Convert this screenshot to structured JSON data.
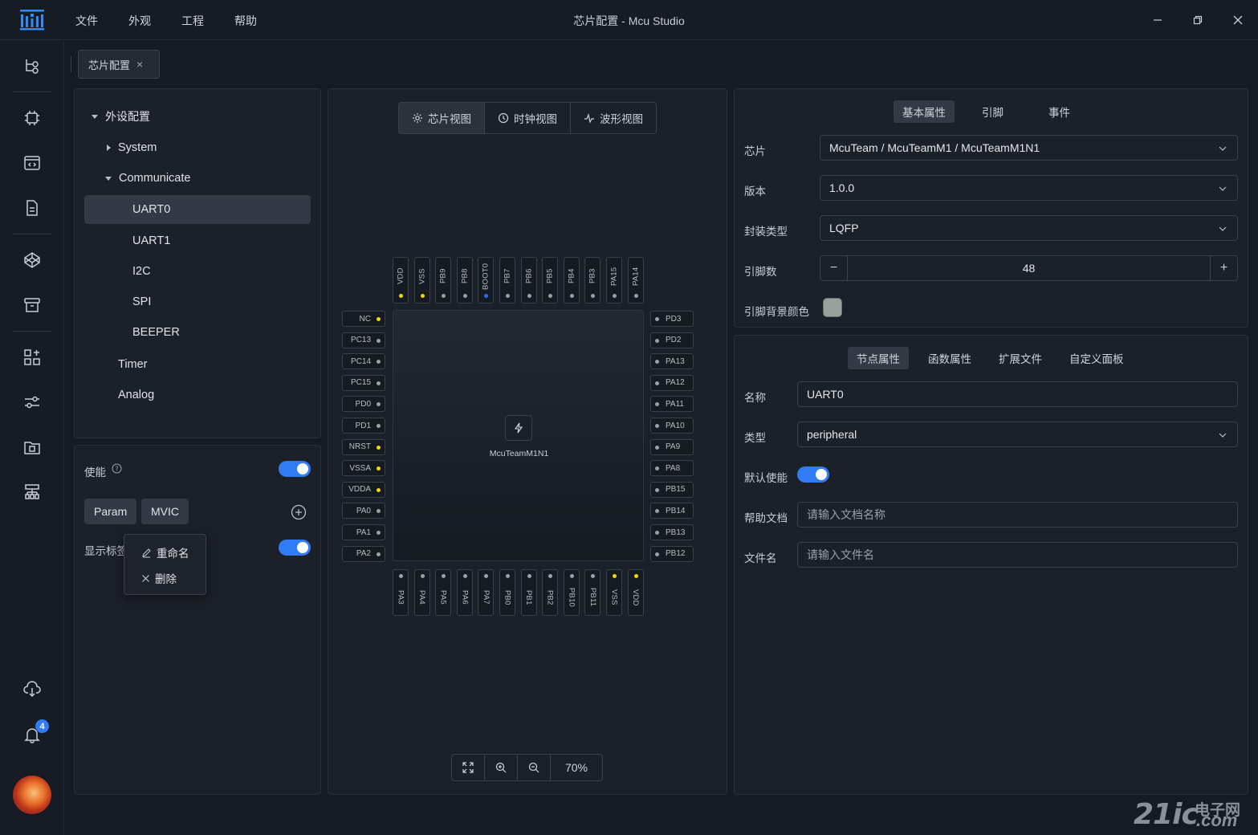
{
  "app": {
    "title": "芯片配置 - Mcu Studio",
    "menu": [
      "文件",
      "外观",
      "工程",
      "帮助"
    ]
  },
  "rail": {
    "icons": [
      "flow-icon",
      "chip-icon",
      "code-window-icon",
      "document-icon",
      "codepen-icon",
      "archive-icon",
      "component-icon",
      "sliders-icon",
      "folder-icon",
      "sitemap-icon",
      "cloud-download-icon",
      "bell-icon"
    ],
    "notification_count": "4"
  },
  "doc_tab": {
    "label": "芯片配置",
    "close": "×"
  },
  "tree": {
    "root": "外设配置",
    "items": [
      {
        "label": "System"
      },
      {
        "label": "Communicate"
      },
      {
        "label": "UART0"
      },
      {
        "label": "UART1"
      },
      {
        "label": "I2C"
      },
      {
        "label": "SPI"
      },
      {
        "label": "BEEPER"
      },
      {
        "label": "Timer"
      },
      {
        "label": "Analog"
      }
    ]
  },
  "options": {
    "enable_label": "使能",
    "enable_on": true,
    "help_icon": "help-circle-icon",
    "chips": [
      "Param",
      "MVIC"
    ],
    "show_label": "显示标签",
    "show_on": true
  },
  "context_menu": {
    "rename": "重命名",
    "delete": "删除"
  },
  "views": {
    "tabs": [
      "芯片视图",
      "时钟视图",
      "波形视图"
    ],
    "active": "芯片视图"
  },
  "chip": {
    "name": "McuTeamM1N1",
    "top_pins": [
      {
        "name": "VDD",
        "dot": "#f5d800"
      },
      {
        "name": "VSS",
        "dot": "#f5d800"
      },
      {
        "name": "PB9",
        "dot": "#9aa0aa"
      },
      {
        "name": "PB8",
        "dot": "#9aa0aa"
      },
      {
        "name": "BOOT0",
        "dot": "#2f6cf6"
      },
      {
        "name": "PB7",
        "dot": "#9aa0aa"
      },
      {
        "name": "PB6",
        "dot": "#9aa0aa"
      },
      {
        "name": "PB5",
        "dot": "#9aa0aa"
      },
      {
        "name": "PB4",
        "dot": "#9aa0aa"
      },
      {
        "name": "PB3",
        "dot": "#9aa0aa"
      },
      {
        "name": "PA15",
        "dot": "#9aa0aa"
      },
      {
        "name": "PA14",
        "dot": "#9aa0aa"
      }
    ],
    "left_pins": [
      {
        "name": "NC",
        "dot": "#f5d800"
      },
      {
        "name": "PC13",
        "dot": "#9aa0aa"
      },
      {
        "name": "PC14",
        "dot": "#9aa0aa"
      },
      {
        "name": "PC15",
        "dot": "#9aa0aa"
      },
      {
        "name": "PD0",
        "dot": "#9aa0aa"
      },
      {
        "name": "PD1",
        "dot": "#9aa0aa"
      },
      {
        "name": "NRST",
        "dot": "#f5d800"
      },
      {
        "name": "VSSA",
        "dot": "#f5d800"
      },
      {
        "name": "VDDA",
        "dot": "#f5d800"
      },
      {
        "name": "PA0",
        "dot": "#9aa0aa"
      },
      {
        "name": "PA1",
        "dot": "#9aa0aa"
      },
      {
        "name": "PA2",
        "dot": "#9aa0aa"
      }
    ],
    "right_pins": [
      {
        "name": "PD3",
        "dot": "#9aa0aa"
      },
      {
        "name": "PD2",
        "dot": "#9aa0aa"
      },
      {
        "name": "PA13",
        "dot": "#9aa0aa"
      },
      {
        "name": "PA12",
        "dot": "#9aa0aa"
      },
      {
        "name": "PA11",
        "dot": "#9aa0aa"
      },
      {
        "name": "PA10",
        "dot": "#9aa0aa"
      },
      {
        "name": "PA9",
        "dot": "#9aa0aa"
      },
      {
        "name": "PA8",
        "dot": "#9aa0aa"
      },
      {
        "name": "PB15",
        "dot": "#9aa0aa"
      },
      {
        "name": "PB14",
        "dot": "#9aa0aa"
      },
      {
        "name": "PB13",
        "dot": "#9aa0aa"
      },
      {
        "name": "PB12",
        "dot": "#9aa0aa"
      }
    ],
    "bottom_pins": [
      {
        "name": "PA3",
        "dot": "#9aa0aa"
      },
      {
        "name": "PA4",
        "dot": "#9aa0aa"
      },
      {
        "name": "PA5",
        "dot": "#9aa0aa"
      },
      {
        "name": "PA6",
        "dot": "#9aa0aa"
      },
      {
        "name": "PA7",
        "dot": "#9aa0aa"
      },
      {
        "name": "PB0",
        "dot": "#9aa0aa"
      },
      {
        "name": "PB1",
        "dot": "#9aa0aa"
      },
      {
        "name": "PB2",
        "dot": "#9aa0aa"
      },
      {
        "name": "PB10",
        "dot": "#9aa0aa"
      },
      {
        "name": "PB11",
        "dot": "#9aa0aa"
      },
      {
        "name": "VSS",
        "dot": "#f5d800"
      },
      {
        "name": "VDD",
        "dot": "#f5d800"
      }
    ]
  },
  "zoom": {
    "level": "70%"
  },
  "basic": {
    "tabs": [
      "基本属性",
      "引脚",
      "事件"
    ],
    "chip_label": "芯片",
    "chip_value": "McuTeam / McuTeamM1 / McuTeamM1N1",
    "version_label": "版本",
    "version_value": "1.0.0",
    "package_label": "封装类型",
    "package_value": "LQFP",
    "pins_label": "引脚数",
    "pins_value": "48",
    "minus": "−",
    "plus": "+",
    "bg_label": "引脚背景颜色",
    "bg_color": "#9aa09a"
  },
  "node": {
    "tabs": [
      "节点属性",
      "函数属性",
      "扩展文件",
      "自定义面板"
    ],
    "name_label": "名称",
    "name_value": "UART0",
    "type_label": "类型",
    "type_value": "peripheral",
    "default_label": "默认使能",
    "default_on": true,
    "help_label": "帮助文档",
    "help_placeholder": "请输入文档名称",
    "file_label": "文件名",
    "file_placeholder": "请输入文件名"
  },
  "watermark": {
    "text1": "21ic",
    "text2": "电子网",
    "text3": ".com"
  },
  "colors": {
    "accent": "#2f7cf6",
    "bg": "#161a22",
    "panel": "#1c2029"
  }
}
